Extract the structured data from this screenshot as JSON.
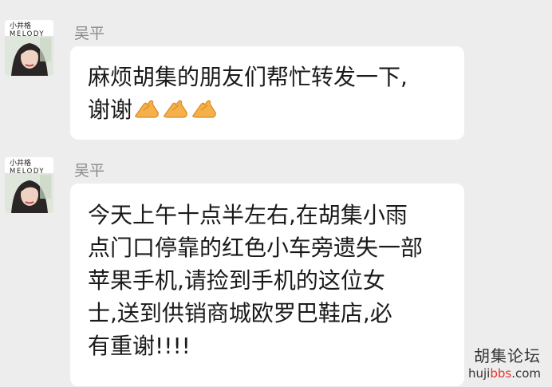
{
  "messages": [
    {
      "sender": "吴平",
      "avatar": {
        "brand_top": "小井格",
        "brand_main": "MELODY"
      },
      "lines": [
        "麻烦胡集的朋友们帮忙转发一下,",
        "谢谢"
      ],
      "trailing_emoji": [
        "folded-hands-icon",
        "folded-hands-icon",
        "folded-hands-icon"
      ]
    },
    {
      "sender": "吴平",
      "avatar": {
        "brand_top": "小井格",
        "brand_main": "MELODY"
      },
      "lines": [
        "今天上午十点半左右,在胡集小雨",
        "点门口停靠的红色小车旁遗失一部",
        "苹果手机,请捡到手机的这位女",
        "士,送到供销商城欧罗巴鞋店,必",
        "有重谢!!!!"
      ]
    }
  ],
  "watermark": {
    "title": "胡集论坛",
    "url_prefix": "huji",
    "url_accent": "bbs",
    "url_suffix": ".com"
  },
  "colors": {
    "background": "#ededed",
    "bubble": "#ffffff",
    "sender_name": "#8a8a8a",
    "watermark_accent": "#e3342f"
  }
}
